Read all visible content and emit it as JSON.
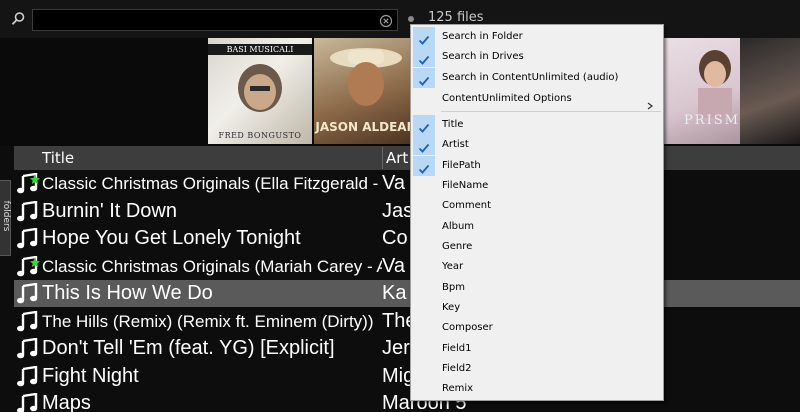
{
  "search": {
    "value": "",
    "placeholder": "",
    "file_count": "125 files"
  },
  "covers": [
    {
      "top_text": "BASI MUSICALI",
      "bottom_text": "FRED BONGUSTO"
    },
    {
      "bottom_text": "JASON ALDEAN"
    },
    {
      "bottom_text": "PRISM"
    },
    {}
  ],
  "side_tab": {
    "label": "folders"
  },
  "table": {
    "columns": [
      "Title",
      "Art"
    ],
    "rows": [
      {
        "title": "Classic Christmas Originals (Ella Fitzgerald - Fr...",
        "artist": "Va",
        "starred": true,
        "condensed": true
      },
      {
        "title": "Burnin' It Down",
        "artist": "Jas",
        "starred": false,
        "condensed": false
      },
      {
        "title": "Hope You Get Lonely Tonight",
        "artist": "Co",
        "starred": false,
        "condensed": false
      },
      {
        "title": "Classic Christmas Originals (Mariah Carey - All...",
        "artist": "Va",
        "starred": true,
        "condensed": true
      },
      {
        "title": "This Is How We Do",
        "artist": "Ka",
        "starred": false,
        "condensed": false,
        "selected": true
      },
      {
        "title": "The Hills (Remix) (Remix ft. Eminem (Dirty))",
        "artist": "The",
        "starred": false,
        "condensed": true
      },
      {
        "title": "Don't Tell 'Em (feat. YG) [Explicit]",
        "artist": "Jer",
        "starred": false,
        "condensed": false
      },
      {
        "title": "Fight Night",
        "artist": "Mig",
        "starred": false,
        "condensed": false
      },
      {
        "title": "Maps",
        "artist": "Maroon 5",
        "starred": false,
        "condensed": false
      }
    ]
  },
  "menu": {
    "items": [
      {
        "label": "Search in Folder",
        "checked": true
      },
      {
        "label": "Search in Drives",
        "checked": true
      },
      {
        "label": "Search in ContentUnlimited (audio)",
        "checked": true
      },
      {
        "label": "ContentUnlimited Options",
        "checked": false,
        "submenu": true
      },
      {
        "label": "Title",
        "checked": true
      },
      {
        "label": "Artist",
        "checked": true
      },
      {
        "label": "FilePath",
        "checked": true
      },
      {
        "label": "FileName",
        "checked": false
      },
      {
        "label": "Comment",
        "checked": false
      },
      {
        "label": "Album",
        "checked": false
      },
      {
        "label": "Genre",
        "checked": false
      },
      {
        "label": "Year",
        "checked": false
      },
      {
        "label": "Bpm",
        "checked": false
      },
      {
        "label": "Key",
        "checked": false
      },
      {
        "label": "Composer",
        "checked": false
      },
      {
        "label": "Field1",
        "checked": false
      },
      {
        "label": "Field2",
        "checked": false
      },
      {
        "label": "Remix",
        "checked": false
      }
    ]
  },
  "colors": {
    "background": "#0d0d0d",
    "header": "#3d3d3d",
    "selected_row": "#5a5a5a",
    "menu_bg": "#f0f0f0",
    "check_highlight": "#b8d8f5",
    "check_mark": "#1f5fb8",
    "star": "#39d439"
  },
  "icons": {
    "search": "search-icon",
    "clear": "close-circle-icon",
    "note": "music-note-icon",
    "check": "check-icon",
    "arrow": "chevron-right-icon"
  }
}
